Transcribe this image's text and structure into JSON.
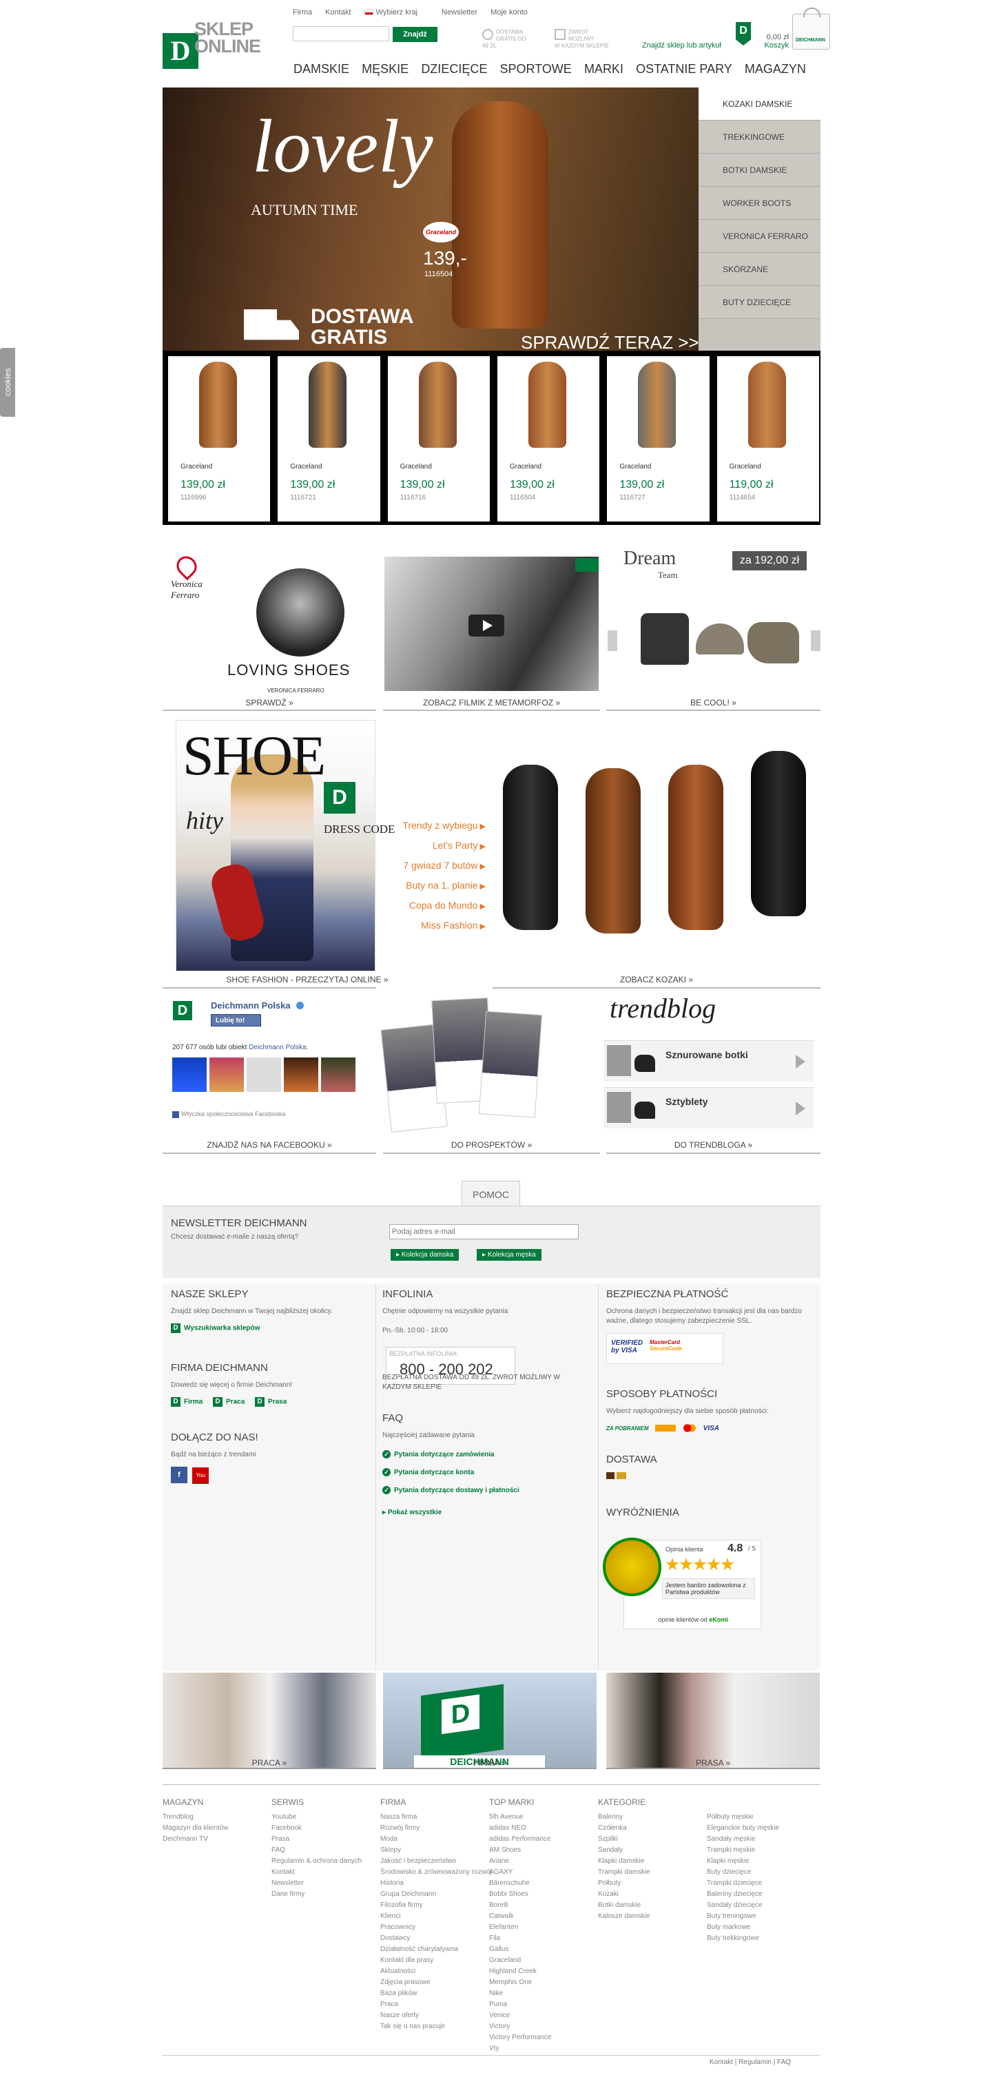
{
  "topbar": {
    "items": [
      "Firma",
      "Kontakt",
      "Wybierz kraj",
      "Newsletter",
      "Moje konto"
    ]
  },
  "logo": {
    "letter": "D",
    "text1": "SKLEP",
    "text2": "ONLINE"
  },
  "search": {
    "placeholder": "",
    "button": "Znajdź"
  },
  "promos": {
    "p1a": "DOSTAWA",
    "p1b": "GRATIS OD 49 ZŁ",
    "p2a": "ZWROT MOŻLIWY",
    "p2b": "W KAŻDYM SKLEPIE"
  },
  "storefinder": "Znajdź sklep lub artykuł",
  "cart": {
    "amount": "0,00 zł",
    "label": "Koszyk"
  },
  "nav": [
    "DAMSKIE",
    "MĘSKIE",
    "DZIECIĘCE",
    "SPORTOWE",
    "MARKI",
    "OSTATNIE PARY",
    "MAGAZYN"
  ],
  "hero": {
    "lovely": "lovely",
    "autumn": "AUTUMN TIME",
    "brand": "Graceland",
    "price": "139,-",
    "sku": "1116504",
    "dostawa1": "DOSTAWA",
    "dostawa2": "GRATIS",
    "cta": "SPRAWDŹ TERAZ >>",
    "side": [
      "KOZAKI DAMSKIE",
      "TREKKINGOWE",
      "BOTKI DAMSKIE",
      "WORKER BOOTS",
      "VERONICA FERRARO",
      "SKÓRZANE",
      "BUTY DZIECIĘCE"
    ]
  },
  "products": [
    {
      "brand": "Graceland",
      "price": "139,00 zł",
      "sku": "1116996",
      "color": "#8a4a20"
    },
    {
      "brand": "Graceland",
      "price": "139,00 zł",
      "sku": "1116721",
      "color": "#3a3a3a"
    },
    {
      "brand": "Graceland",
      "price": "139,00 zł",
      "sku": "1116716",
      "color": "#7a4a30"
    },
    {
      "brand": "Graceland",
      "price": "139,00 zł",
      "sku": "1116504",
      "color": "#9a5025"
    },
    {
      "brand": "Graceland",
      "price": "139,00 zł",
      "sku": "1116727",
      "color": "#6a6a64"
    },
    {
      "brand": "Graceland",
      "price": "119,00 zł",
      "sku": "1114654",
      "color": "#a0582a"
    }
  ],
  "tiles": {
    "vf": {
      "logo1": "Veronica",
      "logo2": "Ferraro",
      "loving": "LOVING SHOES",
      "name": "VERONICA FERRARO",
      "cap": "SPRAWDŹ"
    },
    "video": {
      "cap": "ZOBACZ FILMIK Z METAMORFOZ"
    },
    "dream": {
      "title": "Dream",
      "team": "Team",
      "price": "za 192,00 zł",
      "cap": "BE COOL!"
    },
    "mag": {
      "shoe": "SHOE",
      "hity": "hity",
      "dress": "DRESS CODE",
      "cap": "SHOE FASHION - PRZECZYTAJ ONLINE"
    },
    "trends": [
      "Trendy z wybiegu",
      "Let's Party",
      "7 gwiazd 7 butów",
      "Buty na 1. planie",
      "Copa do Mundo",
      "Miss Fashion"
    ],
    "kozaki": {
      "cap": "ZOBACZ KOZAKI"
    },
    "fb": {
      "name": "Deichmann Polska",
      "like": "Lubię to!",
      "count": "207 677 osób lubi obiekt",
      "countLink": "Deichmann Polska.",
      "plugin": "Wtyczka społecznościowa Facebooka",
      "cap": "ZNAJDŹ NAS NA FACEBOOKU"
    },
    "prosp": {
      "cap": "DO PROSPEKTÓW"
    },
    "blog": {
      "title": "trendblog",
      "items": [
        "Sznurowane botki",
        "Sztyblety"
      ],
      "cap": "DO TRENDBLOGA"
    }
  },
  "pomoc": "POMOC",
  "newsletter": {
    "title": "NEWSLETTER DEICHMANN",
    "sub": "Chcesz dostawać e-maile z naszą ofertą?",
    "placeholder": "Podaj adres e-mail",
    "btn1": "Kolekcja damska",
    "btn2": "Kolekcja męska"
  },
  "info": {
    "sklepy": {
      "h": "NASZE SKLEPY",
      "p": "Znajdź sklep Deichmann w Twojej najbliższej okolicy.",
      "link": "Wyszukiwarka sklepów"
    },
    "firma": {
      "h": "FIRMA DEICHMANN",
      "p": "Dowiedz się więcej o firmie Deichmann!",
      "links": [
        "Firma",
        "Praca",
        "Prasa"
      ]
    },
    "dolacz": {
      "h": "DOŁĄCZ DO NAS!",
      "p": "Bądź na bieżąco z trendami"
    },
    "infolinia": {
      "h": "INFOLINIA",
      "p": "Chętnie odpowiemy na wszystkie pytania",
      "hours": "Pn.-Sb.   10:00 - 18:00",
      "phoneLabel": "BEZPŁATNA INFOLINIA:",
      "phone": "800 - 200 202",
      "note": "BEZPŁATNA DOSTAWA OD 49 ZŁ. ZWROT MOŻLIWY W KAŻDYM SKLEPIE"
    },
    "faq": {
      "h": "FAQ",
      "p": "Najczęściej zadawane pytania",
      "items": [
        "Pytania dotyczące zamówienia",
        "Pytania dotyczące konta",
        "Pytania dotyczące dostawy i płatności"
      ],
      "all": "Pokaż wszystkie"
    },
    "platnosc": {
      "h": "BEZPIECZNA PŁATNOŚĆ",
      "p": "Ochrona danych i bezpieczeństwo transakcji jest dla nas bardzo ważne, dlatego stosujemy zabezpieczenie SSL."
    },
    "sposoby": {
      "h": "SPOSOBY PŁATNOŚCI",
      "p": "Wybierz najdogodniejszy dla siebie sposób płatności:"
    },
    "dostawa": {
      "h": "DOSTAWA"
    },
    "wyroznienia": {
      "h": "WYRÓŻNIENIA",
      "opinia": "Opinia klienta",
      "score": "4.8",
      "of": "/ 5",
      "quote": "Jestem bardzo zadowolona z Państwa produktów",
      "footer": "opinie klientów od",
      "ekomi": "eKomi"
    }
  },
  "photoTiles": [
    "PRACA",
    "FIRMA",
    "PRASA"
  ],
  "footer": {
    "magazyn": {
      "h": "MAGAZYN",
      "items": [
        "Trendblog",
        "Magazyn dla klientów",
        "Deichmann TV"
      ]
    },
    "serwis": {
      "h": "SERWIS",
      "items": [
        "Youtube",
        "Facebook",
        "Prasa",
        "FAQ",
        "Regulamin & ochrona danych",
        "Kontakt",
        "Newsletter",
        "Dane firmy"
      ]
    },
    "firma": {
      "h": "FIRMA",
      "items": [
        "Nasza firma",
        "Rozwój firmy",
        "Moda",
        "Sklepy",
        "Jakość i bezpieczeństwo",
        "Środowisko & zrównoważony rozwój",
        "Historia",
        "Grupa Deichmann",
        "Filozofia firmy",
        "Klienci",
        "Pracownicy",
        "Dostawcy",
        "Działalność charytatywna",
        "Kontakt dla prasy",
        "Aktualności",
        "Zdjęcia prasowe",
        "Baza plików",
        "Praca",
        "Nasze oferty",
        "Tak się u nas pracuje"
      ]
    },
    "marki": {
      "h": "TOP MARKI",
      "items": [
        "5th Avenue",
        "adidas NEO",
        "adidas Performance",
        "AM Shoes",
        "Ariane",
        "AGAXY",
        "Bärenschuhe",
        "Bobbi Shoes",
        "Borelli",
        "Catwalk",
        "Elefanten",
        "Fila",
        "Gallus",
        "Graceland",
        "Highland Creek",
        "Memphis One",
        "Nike",
        "Puma",
        "Venice",
        "Victory",
        "Victory Performance",
        "Vty"
      ]
    },
    "kategorie": {
      "h": "KATEGORIE",
      "items": [
        "Baleriny",
        "Czółenka",
        "Szpilki",
        "Sandały",
        "Klapki damskie",
        "Trampki damskie",
        "Półbuty",
        "Kozaki",
        "Botki damskie",
        "Kalosze damskie"
      ]
    },
    "kat2": {
      "items": [
        "Półbuty męskie",
        "Eleganckie buty męskie",
        "Sandały męskie",
        "Trampki męskie",
        "Klapki męskie",
        "Buty dziecięce",
        "Trampki dziecięce",
        "Baleriny dziecięce",
        "Sandały dziecięce",
        "Buty treningowe",
        "Buty markowe",
        "Buty trekkingowe"
      ]
    },
    "bottom": [
      "Kontakt",
      "Regulamin",
      "FAQ"
    ]
  },
  "cookies": "cookies"
}
